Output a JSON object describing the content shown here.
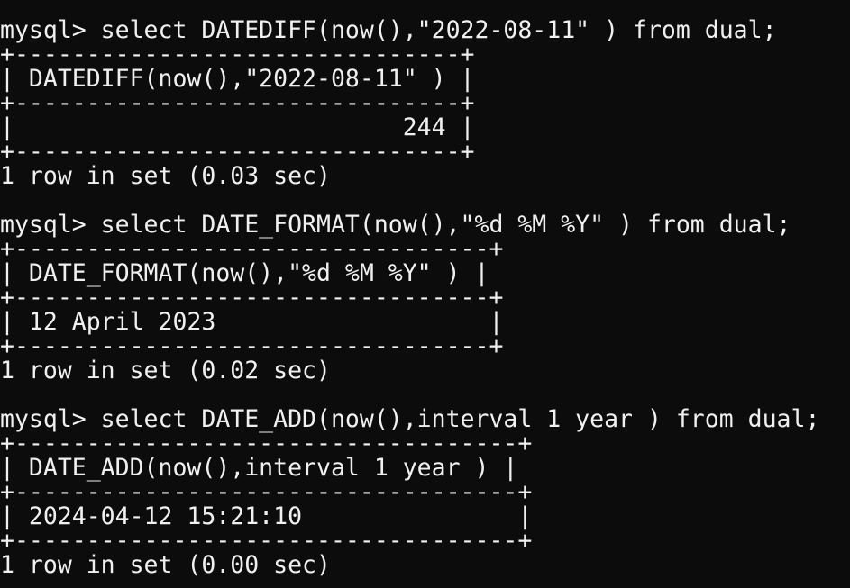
{
  "terminal": {
    "lines": [
      "mysql> select DATEDIFF(now(),\"2022-08-11\" ) from dual;",
      "+-------------------------------+",
      "| DATEDIFF(now(),\"2022-08-11\" ) |",
      "+-------------------------------+",
      "|                           244 |",
      "+-------------------------------+",
      "1 row in set (0.03 sec)",
      "",
      "mysql> select DATE_FORMAT(now(),\"%d %M %Y\" ) from dual;",
      "+---------------------------------+",
      "| DATE_FORMAT(now(),\"%d %M %Y\" ) |",
      "+---------------------------------+",
      "| 12 April 2023                   |",
      "+---------------------------------+",
      "1 row in set (0.02 sec)",
      "",
      "mysql> select DATE_ADD(now(),interval 1 year ) from dual;",
      "+-----------------------------------+",
      "| DATE_ADD(now(),interval 1 year ) |",
      "+-----------------------------------+",
      "| 2024-04-12 15:21:10               |",
      "+-----------------------------------+",
      "1 row in set (0.00 sec)"
    ]
  }
}
